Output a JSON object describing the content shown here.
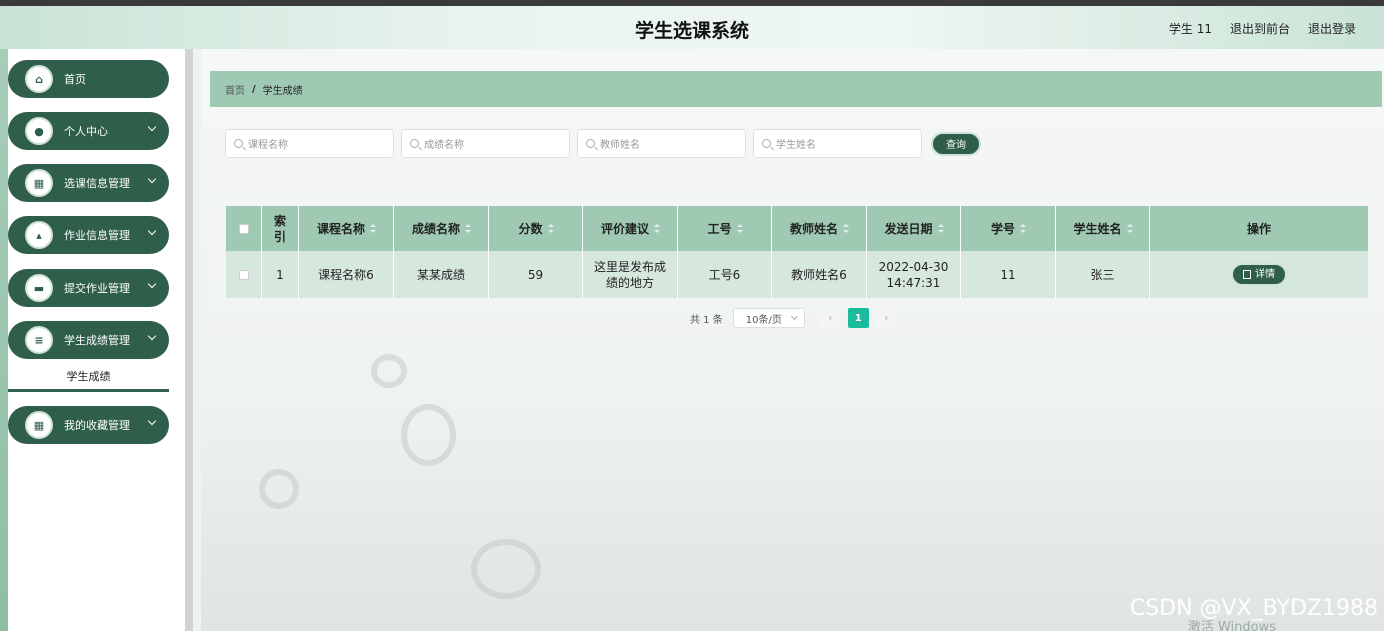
{
  "header": {
    "title": "学生选课系统",
    "user_label": "学生 11",
    "to_front_label": "退出到前台",
    "logout_label": "退出登录"
  },
  "sidebar": {
    "items": [
      {
        "label": "首页",
        "icon": "home-icon",
        "glyph": "⌂",
        "expandable": false
      },
      {
        "label": "个人中心",
        "icon": "user-icon",
        "glyph": "●",
        "expandable": true
      },
      {
        "label": "选课信息管理",
        "icon": "grid-icon",
        "glyph": "▦",
        "expandable": true
      },
      {
        "label": "作业信息管理",
        "icon": "person-icon",
        "glyph": "▴",
        "expandable": true
      },
      {
        "label": "提交作业管理",
        "icon": "monitor-icon",
        "glyph": "▬",
        "expandable": true
      },
      {
        "label": "学生成绩管理",
        "icon": "list-icon",
        "glyph": "≡",
        "expandable": true
      },
      {
        "label": "我的收藏管理",
        "icon": "grid-icon",
        "glyph": "▦",
        "expandable": true
      }
    ],
    "active_submenu": "学生成绩"
  },
  "breadcrumb": {
    "home": "首页",
    "separator": "/",
    "current": "学生成绩"
  },
  "search": {
    "course_placeholder": "课程名称",
    "score_name_placeholder": "成绩名称",
    "teacher_placeholder": "教师姓名",
    "student_placeholder": "学生姓名",
    "query_label": "查询"
  },
  "table": {
    "headers": [
      "索引",
      "课程名称",
      "成绩名称",
      "分数",
      "评价建议",
      "工号",
      "教师姓名",
      "发送日期",
      "学号",
      "学生姓名",
      "操作"
    ],
    "rows": [
      {
        "index": "1",
        "course": "课程名称6",
        "score_name": "某某成绩",
        "score": "59",
        "comment": "这里是发布成绩的地方",
        "staff_no": "工号6",
        "teacher": "教师姓名6",
        "date": "2022-04-30 14:47:31",
        "student_no": "11",
        "student": "张三",
        "action": "详情"
      }
    ]
  },
  "pagination": {
    "total": "共 1 条",
    "page_size": "10条/页",
    "current_page": "1",
    "prev": "‹",
    "next": "›"
  },
  "overlay": {
    "watermark": "CSDN @VX_BYDZ1988",
    "activate": "激活 Windows"
  },
  "colors": {
    "primary": "#2f5e4a",
    "header_bg": "#9fc9b3",
    "row_bg": "#d6e7dd",
    "pager_active": "#1abc9c"
  }
}
